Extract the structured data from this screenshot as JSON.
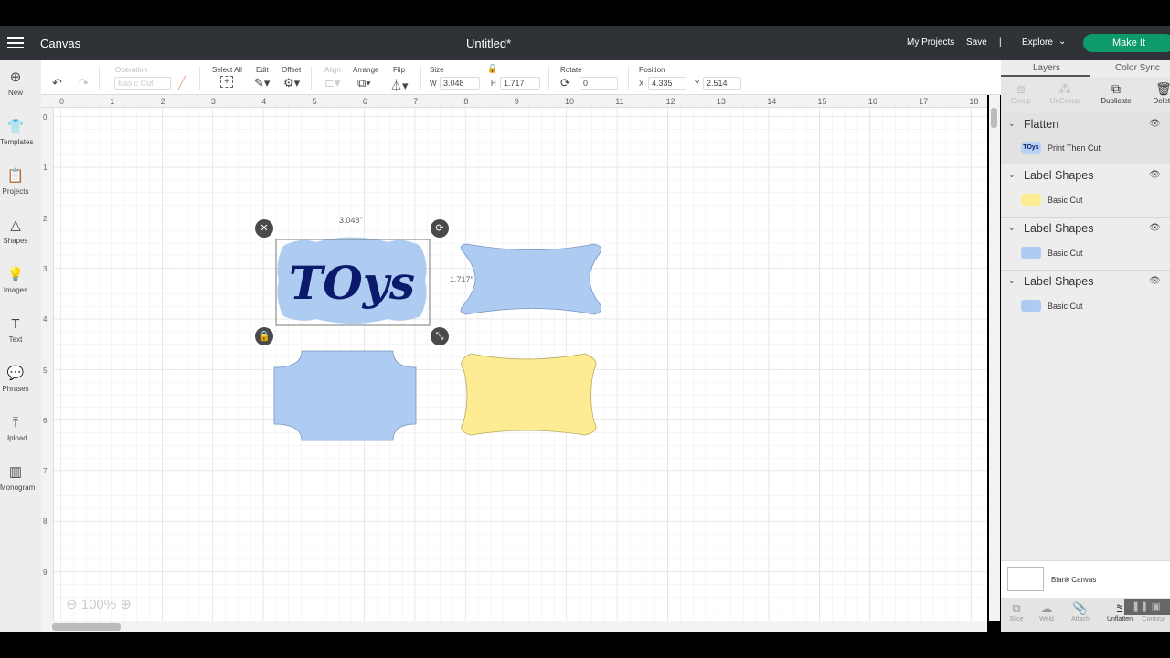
{
  "header": {
    "section": "Canvas",
    "title": "Untitled*",
    "my_projects": "My Projects",
    "save": "Save",
    "divider": "|",
    "explore": "Explore",
    "make_it": "Make It"
  },
  "sidebar": {
    "items": [
      {
        "label": "New",
        "icon": "plus-circle-icon"
      },
      {
        "label": "Templates",
        "icon": "shirt-icon"
      },
      {
        "label": "Projects",
        "icon": "clipboard-icon"
      },
      {
        "label": "Shapes",
        "icon": "shapes-icon"
      },
      {
        "label": "Images",
        "icon": "bulb-icon"
      },
      {
        "label": "Text",
        "icon": "text-icon"
      },
      {
        "label": "Phrases",
        "icon": "speech-icon"
      },
      {
        "label": "Upload",
        "icon": "upload-icon"
      },
      {
        "label": "Monogram",
        "icon": "monogram-icon"
      }
    ]
  },
  "toolbar": {
    "operation_label": "Operation",
    "operation_value": "Basic Cut",
    "select_all": "Select All",
    "edit": "Edit",
    "offset": "Offset",
    "align": "Align",
    "arrange": "Arrange",
    "flip": "Flip",
    "size": "Size",
    "w_label": "W",
    "w": "3.048",
    "h_label": "H",
    "h": "1.717",
    "rotate": "Rotate",
    "rotate_value": "0",
    "position": "Position",
    "x_label": "X",
    "x": "4.335",
    "y_label": "Y",
    "y": "2.514"
  },
  "rulers": {
    "top": [
      "0",
      "1",
      "2",
      "3",
      "4",
      "5",
      "6",
      "7",
      "8",
      "9",
      "10",
      "11",
      "12",
      "13",
      "14",
      "15",
      "16",
      "17",
      "18"
    ],
    "left": [
      "0",
      "1",
      "2",
      "3",
      "4",
      "5",
      "6",
      "7",
      "8",
      "9"
    ]
  },
  "canvas": {
    "selection_width": "3.048\"",
    "selection_height": "1.717\"",
    "text": "TOys",
    "zoom": "100%"
  },
  "panel": {
    "tabs": [
      "Layers",
      "Color Sync"
    ],
    "actions": [
      "Group",
      "UnGroup",
      "Duplicate",
      "Delete"
    ],
    "groups": [
      {
        "name": "Flatten",
        "item": "Print Then Cut",
        "swatch_text": "TOys",
        "color": "#b6d3f5"
      },
      {
        "name": "Label Shapes",
        "item": "Basic Cut",
        "color": "#fdec94"
      },
      {
        "name": "Label Shapes",
        "item": "Basic Cut",
        "color": "#aecbf2"
      },
      {
        "name": "Label Shapes",
        "item": "Basic Cut",
        "color": "#aecbf2"
      }
    ],
    "blank_canvas": "Blank Canvas",
    "bottom": [
      "Slice",
      "Weld",
      "Attach",
      "Unflatten",
      "Contour"
    ]
  },
  "colors": {
    "accent": "#0d9b6c",
    "blue_shape": "#aecbf2",
    "yellow_shape": "#fdec94",
    "text": "#0c1a6b"
  }
}
